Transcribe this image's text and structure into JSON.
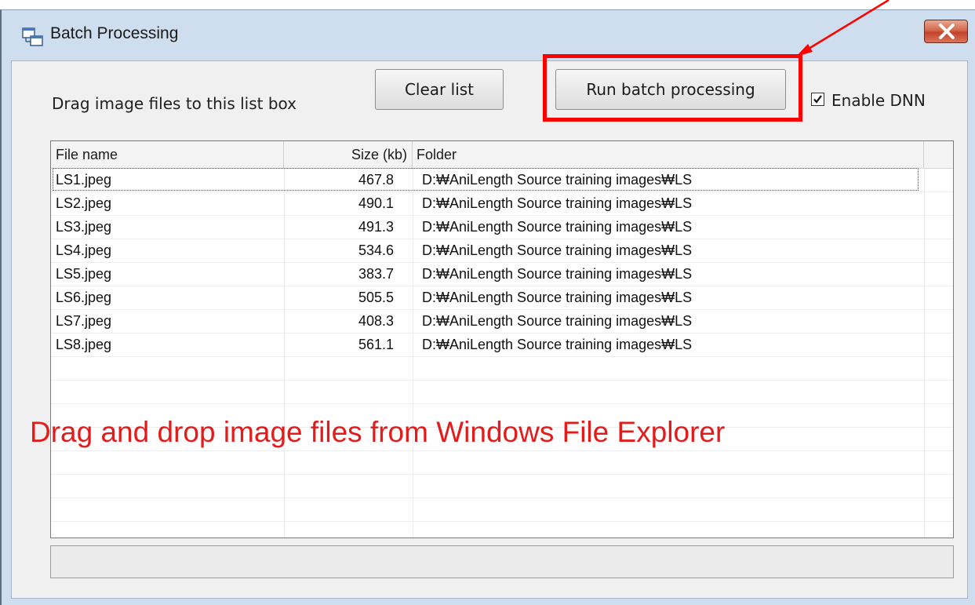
{
  "window": {
    "title": "Batch Processing",
    "close_icon": "close-x-icon",
    "app_icon": "batch-windows-icon"
  },
  "hint": "Drag image files to this list box",
  "buttons": {
    "clear_label": "Clear list",
    "run_label": "Run batch processing"
  },
  "checkbox": {
    "label": "Enable DNN",
    "checked": true
  },
  "list": {
    "columns": [
      "File name",
      "Size (kb)",
      "Folder"
    ],
    "rows": [
      {
        "name": "LS1.jpeg",
        "size": "467.8",
        "folder": "D:₩AniLength Source training images₩LS"
      },
      {
        "name": "LS2.jpeg",
        "size": "490.1",
        "folder": "D:₩AniLength Source training images₩LS"
      },
      {
        "name": "LS3.jpeg",
        "size": "491.3",
        "folder": "D:₩AniLength Source training images₩LS"
      },
      {
        "name": "LS4.jpeg",
        "size": "534.6",
        "folder": "D:₩AniLength Source training images₩LS"
      },
      {
        "name": "LS5.jpeg",
        "size": "383.7",
        "folder": "D:₩AniLength Source training images₩LS"
      },
      {
        "name": "LS6.jpeg",
        "size": "505.5",
        "folder": "D:₩AniLength Source training images₩LS"
      },
      {
        "name": "LS7.jpeg",
        "size": "408.3",
        "folder": "D:₩AniLength Source training images₩LS"
      },
      {
        "name": "LS8.jpeg",
        "size": "561.1",
        "folder": "D:₩AniLength Source training images₩LS"
      }
    ]
  },
  "annotation": "Drag and drop image files from Windows File Explorer",
  "colors": {
    "annotation": "#e31b1b",
    "highlight": "#ff0000",
    "window_frame": "#cfdeee"
  }
}
